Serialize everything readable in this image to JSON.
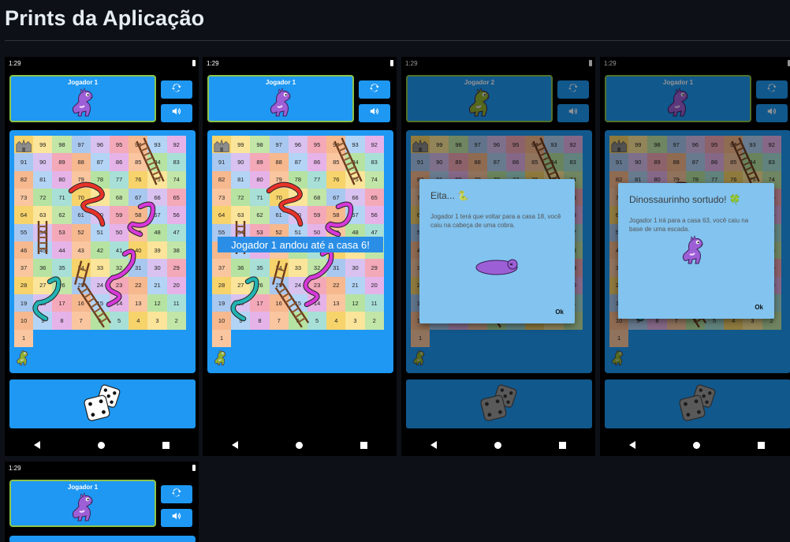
{
  "page": {
    "heading": "Prints da Aplicação"
  },
  "status_time": "1:29",
  "board_numbers": [
    [
      "",
      "99",
      "98",
      "97",
      "96",
      "95",
      "94",
      "93",
      "92"
    ],
    [
      "91",
      "90",
      "89",
      "88",
      "87",
      "86",
      "85",
      "84",
      "83"
    ],
    [
      "82",
      "81",
      "80",
      "79",
      "78",
      "77",
      "76",
      "75",
      "74"
    ],
    [
      "73",
      "72",
      "71",
      "70",
      "69",
      "68",
      "67",
      "66",
      "65"
    ],
    [
      "64",
      "63",
      "62",
      "61",
      "60",
      "59",
      "58",
      "57",
      "56"
    ],
    [
      "55",
      "54",
      "53",
      "52",
      "51",
      "50",
      "49",
      "48",
      "47"
    ],
    [
      "46",
      "45",
      "44",
      "43",
      "42",
      "41",
      "40",
      "39",
      "38"
    ],
    [
      "37",
      "36",
      "35",
      "34",
      "33",
      "32",
      "31",
      "30",
      "29"
    ],
    [
      "28",
      "27",
      "26",
      "25",
      "24",
      "23",
      "22",
      "21",
      "20"
    ],
    [
      "19",
      "18",
      "17",
      "16",
      "15",
      "14",
      "13",
      "12",
      "11"
    ],
    [
      "10",
      "9",
      "8",
      "7",
      "6",
      "5",
      "4",
      "3",
      "2"
    ],
    [
      "1",
      "",
      "",
      "",
      "",
      "",
      "",
      "",
      ""
    ]
  ],
  "screens": [
    {
      "player_name": "Jogador 1",
      "dino": "purple"
    },
    {
      "player_name": "Jogador 1",
      "dino": "purple",
      "toast": "Jogador 1 andou até a casa 6!"
    },
    {
      "player_name": "Jogador 2",
      "dino": "green",
      "dialog": {
        "title": "Eita... 🐍",
        "body": "Jogador 1 terá que voltar para a casa 18, você caiu na cabeça de uma cobra.",
        "ok": "Ok"
      }
    },
    {
      "player_name": "Jogador 1",
      "dino": "purple",
      "dialog": {
        "title": "Dinossaurinho sortudo! 🍀",
        "body": "Jogador 1 irá para a casa 63, você caiu na base de uma escada.",
        "ok": "Ok"
      }
    },
    {
      "player_name": "Jogador 1",
      "dino": "purple"
    }
  ],
  "icons": {
    "restart": "refresh-icon",
    "sound": "volume-icon",
    "start": "castle-icon",
    "dice": "dice-icon"
  },
  "colors": {
    "panel": "#1e98f3",
    "card_border": "#8ec44a",
    "dialog": "#82c3ef",
    "dino_purple": "#9d5fd6",
    "dino_green": "#8fb232",
    "snake_red": "#e8322a",
    "snake_magenta": "#d639d8",
    "snake_teal": "#23b3b3",
    "ladder": "#6b3a1f"
  }
}
